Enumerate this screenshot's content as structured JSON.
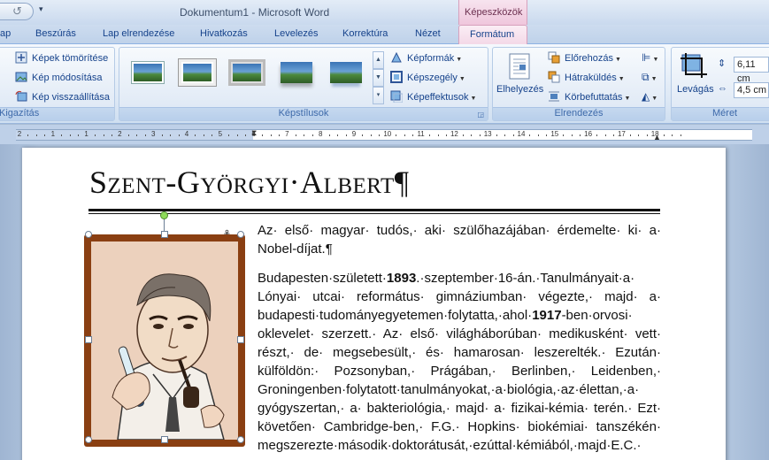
{
  "titlebar": {
    "app_title": "Dokumentum1 - Microsoft Word",
    "context_tab_group": "Képeszközök",
    "undo_icon": "undo-icon",
    "qat_dropdown": "▾"
  },
  "tabs": [
    {
      "label": "ap"
    },
    {
      "label": "Beszúrás"
    },
    {
      "label": "Lap elrendezése"
    },
    {
      "label": "Hivatkozás"
    },
    {
      "label": "Levelezés"
    },
    {
      "label": "Korrektúra"
    },
    {
      "label": "Nézet"
    }
  ],
  "active_tab": "Formátum",
  "ribbon": {
    "adjust": {
      "compress": "Képek tömörítése",
      "change": "Kép módosítása",
      "reset": "Kép visszaállítása",
      "label": "Kigazítás"
    },
    "styles": {
      "shape": "Képformák",
      "border": "Képszegély",
      "effects": "Képeffektusok",
      "label": "Képstílusok"
    },
    "arrange": {
      "position": "Elhelyezés",
      "front": "Előrehozás",
      "back": "Hátraküldés",
      "wrap": "Körbefuttatás",
      "label": "Elrendezés"
    },
    "size": {
      "crop": "Levágás",
      "height": "6,11 cm",
      "width": "4,5 cm",
      "label": "Méret"
    }
  },
  "ruler": {
    "labels": [
      "2",
      "1",
      "1",
      "2",
      "3",
      "4",
      "5",
      "6",
      "7",
      "8",
      "9",
      "10",
      "11",
      "12",
      "13",
      "14",
      "15",
      "16",
      "17",
      "18"
    ]
  },
  "document": {
    "title": "Szent-Györgyi·Albert¶",
    "paragraph1": "Az· első· magyar· tudós,· aki· szülőhazájában· érdemelte· ki· a· Nobel-díjat.¶",
    "paragraph2_parts": {
      "p1": "Budapesten·született·",
      "year1": "1893",
      "p2": ".·szeptember·16-án.·Tanulmányait·a· Lónyai· utcai· református· gimnáziumban· végezte,· majd· a· budapesti·tudományegyetemen·folytatta,·ahol·",
      "year2": "1917",
      "p3": "-ben·orvosi· oklevelet· szerzett.· Az· első· világháborúban· medikusként· vett· részt,· de· megsebesült,· és· hamarosan· leszerelték.· Ezután· külföldön:· Pozsonyban,· Prágában,· Berlinben,· Leidenben,· Groningenben·folytatott·tanulmányokat,·a·biológia,·az·élettan,·a· gyógyszertan,· a· bakteriológia,· majd· a· fizikai-kémia· terén.· Ezt· követően· Cambridge-ben,· F.G.· Hopkins· biokémiai· tanszékén· megszerezte·második·doktorátusát,·ezúttal·kémiából,·majd·E.C.·"
    }
  },
  "colors": {
    "picture_border": "#8a3f12",
    "context_tab": "#efc6dc",
    "ribbon_text": "#15428b"
  }
}
